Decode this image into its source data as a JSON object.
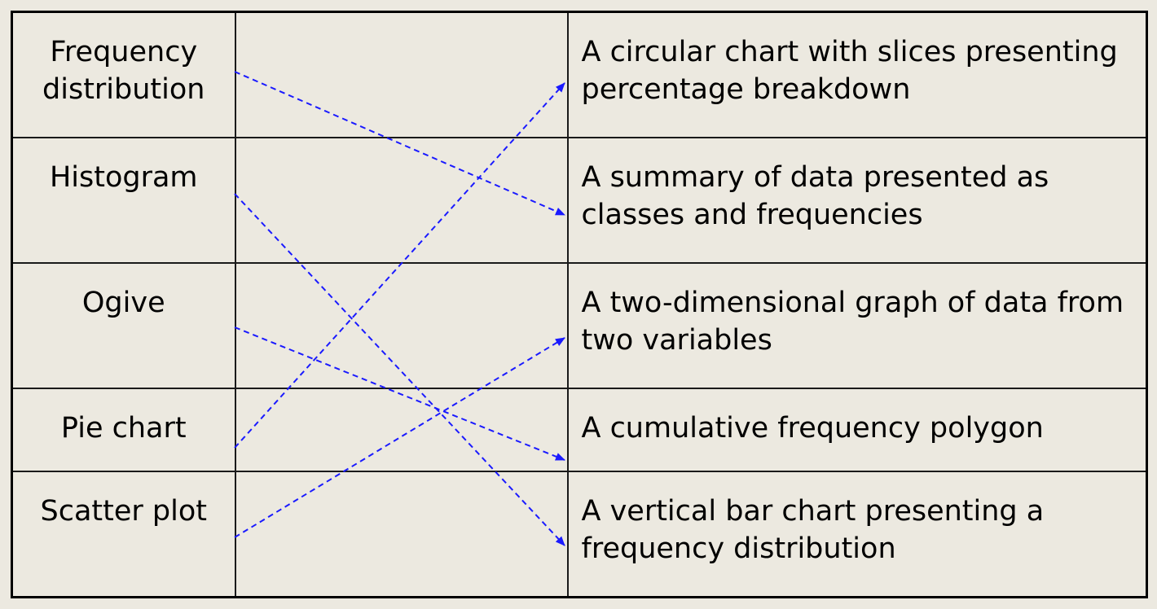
{
  "terms": [
    "Frequency distribution",
    "Histogram",
    "Ogive",
    "Pie chart",
    "Scatter plot"
  ],
  "definitions": [
    "A circular chart with slices presenting percentage breakdown",
    "A summary of data presented as classes and frequencies",
    "A two-dimensional graph of data from two variables",
    "A cumulative frequency polygon",
    "A vertical bar chart presenting a frequency distribution"
  ],
  "matches": [
    {
      "term": "Frequency distribution",
      "definition": "A summary of data presented as classes and frequencies"
    },
    {
      "term": "Histogram",
      "definition": "A vertical bar chart presenting a frequency distribution"
    },
    {
      "term": "Ogive",
      "definition": "A cumulative frequency polygon"
    },
    {
      "term": "Pie chart",
      "definition": "A circular chart with slices presenting percentage breakdown"
    },
    {
      "term": "Scatter plot",
      "definition": "A two-dimensional graph of data from two variables"
    }
  ],
  "arrow_color": "#1a1aff"
}
